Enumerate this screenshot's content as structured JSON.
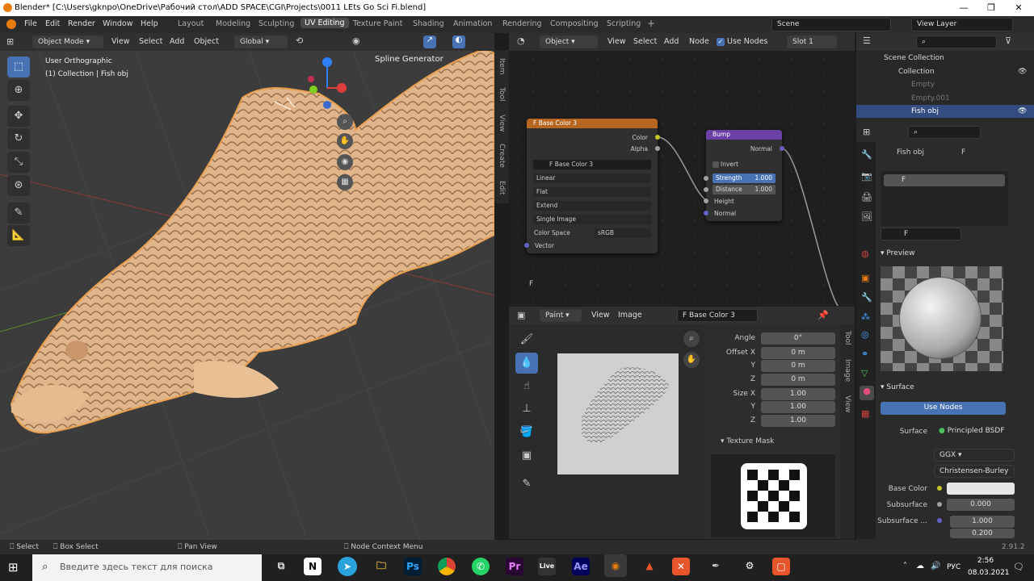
{
  "title_bar": {
    "text": "Blender* [C:\\Users\\gknpo\\OneDrive\\Рабочий стол\\ADD SPACE\\CGI\\Projects\\0011 LEts Go Sci Fi.blend]"
  },
  "menu": [
    "File",
    "Edit",
    "Render",
    "Window",
    "Help"
  ],
  "workspaces": [
    "Layout",
    "Modeling",
    "Sculpting",
    "UV Editing",
    "Texture Paint",
    "Shading",
    "Animation",
    "Rendering",
    "Compositing",
    "Scripting"
  ],
  "scene": {
    "name": "Scene",
    "view_layer": "View Layer"
  },
  "viewport": {
    "mode": "Object Mode",
    "menus": [
      "View",
      "Select",
      "Add",
      "Object"
    ],
    "transform": "Global",
    "view_name": "User Orthographic",
    "collection": "(1) Collection | Fish obj",
    "spline_panel": "Spline Generator",
    "side_tabs": [
      "Item",
      "Tool",
      "View",
      "Create",
      "Edit"
    ]
  },
  "node_editor": {
    "type": "Object",
    "menus": [
      "View",
      "Select",
      "Add",
      "Node"
    ],
    "use_nodes": "Use Nodes",
    "slot": "Slot 1",
    "image_node": {
      "title": "F Base Color 3",
      "out_color": "Color",
      "out_alpha": "Alpha",
      "image": "F Base Color 3",
      "options": [
        "Linear",
        "Flat",
        "Extend",
        "Single Image"
      ],
      "color_space_label": "Color Space",
      "color_space": "sRGB",
      "in_vector": "Vector"
    },
    "bump_node": {
      "title": "Bump",
      "out_normal": "Normal",
      "invert": "Invert",
      "strength_label": "Strength",
      "strength": "1.000",
      "distance_label": "Distance",
      "distance": "1.000",
      "in_height": "Height",
      "in_normal": "Normal"
    },
    "frame_label": "F"
  },
  "image_editor": {
    "mode": "Paint",
    "menus": [
      "View",
      "Image"
    ],
    "image": "F Base Color 3",
    "props": [
      {
        "label": "Angle",
        "value": "0°"
      },
      {
        "label": "Offset X",
        "value": "0 m"
      },
      {
        "label": "Y",
        "value": "0 m"
      },
      {
        "label": "Z",
        "value": "0 m"
      },
      {
        "label": "Size X",
        "value": "1.00"
      },
      {
        "label": "Y",
        "value": "1.00"
      },
      {
        "label": "Z",
        "value": "1.00"
      }
    ],
    "texture_mask": "Texture Mask",
    "side_tabs": [
      "Tool",
      "Image",
      "View"
    ]
  },
  "outliner": {
    "root": "Scene Collection",
    "items": [
      {
        "name": "Collection"
      },
      {
        "name": "Empty"
      },
      {
        "name": "Empty.001"
      },
      {
        "name": "Fish obj"
      }
    ]
  },
  "properties": {
    "object": "Fish obj",
    "material": "F",
    "slot_name": "F",
    "mat_field": "F",
    "preview": "Preview",
    "surface_header": "Surface",
    "use_nodes": "Use Nodes",
    "surface_label": "Surface",
    "surface_value": "Principled BSDF",
    "distribution": "GGX",
    "subsurface_method": "Christensen-Burley",
    "base_color_label": "Base Color",
    "subsurface_label": "Subsurface",
    "subsurface_value": "0.000",
    "subsurface_radius_label": "Subsurface ...",
    "subsurface_radius": [
      "1.000",
      "0.200"
    ]
  },
  "statusbar": {
    "select": "Select",
    "box_select": "Box Select",
    "pan_view": "Pan View",
    "node_menu": "Node Context Menu",
    "version": "2.91.2"
  },
  "taskbar": {
    "search_placeholder": "Введите здесь текст для поиска",
    "lang": "РУС",
    "time": "2:56",
    "date": "08.03.2021"
  }
}
